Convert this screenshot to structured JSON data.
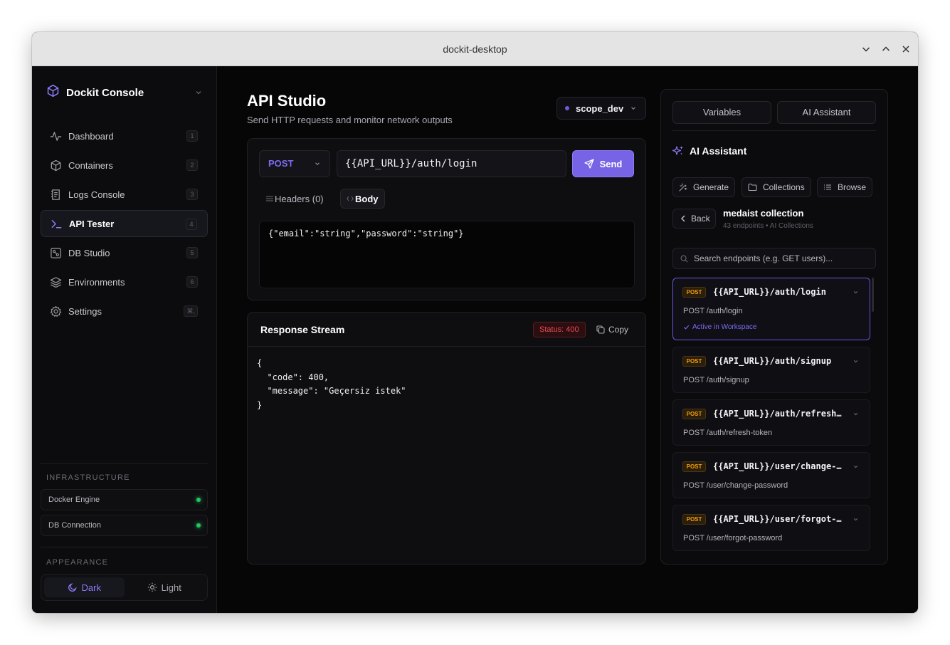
{
  "window": {
    "title": "dockit-desktop"
  },
  "sidebar": {
    "brand": "Dockit Console",
    "items": [
      {
        "label": "Dashboard",
        "key": "1",
        "icon": "activity-icon"
      },
      {
        "label": "Containers",
        "key": "2",
        "icon": "box-icon"
      },
      {
        "label": "Logs Console",
        "key": "3",
        "icon": "logs-icon"
      },
      {
        "label": "API Tester",
        "key": "4",
        "icon": "terminal-icon",
        "active": true
      },
      {
        "label": "DB Studio",
        "key": "5",
        "icon": "database-icon"
      },
      {
        "label": "Environments",
        "key": "6",
        "icon": "layers-icon"
      },
      {
        "label": "Settings",
        "key": "⌘,",
        "icon": "gear-icon"
      }
    ],
    "infrastructure": {
      "title": "INFRASTRUCTURE",
      "items": [
        {
          "label": "Docker Engine",
          "status": "online"
        },
        {
          "label": "DB Connection",
          "status": "online"
        }
      ]
    },
    "appearance": {
      "title": "APPEARANCE",
      "dark": "Dark",
      "light": "Light",
      "selected": "Dark"
    }
  },
  "main": {
    "title": "API Studio",
    "subtitle": "Send HTTP requests and monitor network outputs",
    "scope": "scope_dev",
    "request": {
      "method": "POST",
      "url": "{{API_URL}}/auth/login",
      "send_label": "Send",
      "tabs": {
        "headers": "Headers (0)",
        "body": "Body"
      },
      "active_tab": "Body",
      "body": "{\"email\":\"string\",\"password\":\"string\"}"
    },
    "response": {
      "title": "Response Stream",
      "status": "Status: 400",
      "copy_label": "Copy",
      "body": "{\n  \"code\": 400,\n  \"message\": \"Geçersiz istek\"\n}"
    }
  },
  "panel": {
    "tabs": {
      "variables": "Variables",
      "assistant": "AI Assistant"
    },
    "assistant_title": "AI Assistant",
    "actions": {
      "generate": "Generate",
      "collections": "Collections",
      "browse": "Browse"
    },
    "back_label": "Back",
    "collection": {
      "name": "medaist collection",
      "meta": "43 endpoints • AI Collections"
    },
    "search_placeholder": "Search endpoints (e.g. GET users)...",
    "active_tag": "Active in Workspace",
    "endpoints": [
      {
        "method": "POST",
        "path": "{{API_URL}}/auth/login",
        "route": "POST /auth/login",
        "active": true
      },
      {
        "method": "POST",
        "path": "{{API_URL}}/auth/signup",
        "route": "POST /auth/signup"
      },
      {
        "method": "POST",
        "path": "{{API_URL}}/auth/refresh-token",
        "route": "POST /auth/refresh-token"
      },
      {
        "method": "POST",
        "path": "{{API_URL}}/user/change-password",
        "route": "POST /user/change-password"
      },
      {
        "method": "POST",
        "path": "{{API_URL}}/user/forgot-password",
        "route": "POST /user/forgot-password"
      }
    ]
  },
  "colors": {
    "accent": "#7763e6",
    "status_error": "#ef4a55",
    "method_post": "#f59e0b",
    "online": "#22c55e"
  }
}
